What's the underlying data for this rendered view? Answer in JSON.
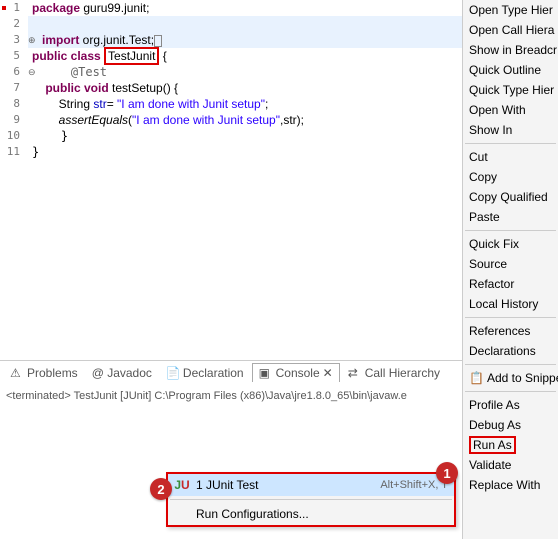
{
  "code": {
    "line1_pkg": "package",
    "line1_rest": " guru99.junit;",
    "line3_imp": "import",
    "line3_rest": " org.junit.Test;",
    "line5_pub": "public",
    "line5_cls": " class ",
    "line5_name": "TestJunit",
    "line5_brace": " {",
    "line6": "    @Test",
    "line7_pub": "    public",
    "line7_void": " void",
    "line7_rest": " testSetup() {",
    "line8_pre": "        String ",
    "line8_var": "str",
    "line8_eq": "= ",
    "line8_str": "\"I am done with Junit setup\"",
    "line8_end": ";",
    "line9_pre": "        ",
    "line9_mth": "assertEquals",
    "line9_open": "(",
    "line9_str": "\"I am done with Junit setup\"",
    "line9_end": ",str);",
    "line10": "    }",
    "line11": "}"
  },
  "tabs": {
    "problems": "Problems",
    "javadoc": "@ Javadoc",
    "declaration": "Declaration",
    "console": "Console",
    "callhier": "Call Hierarchy"
  },
  "terminated": "<terminated> TestJunit [JUnit] C:\\Program Files (x86)\\Java\\jre1.8.0_65\\bin\\javaw.e",
  "menu": {
    "openTypeHier": "Open Type Hier",
    "openCallHier": "Open Call Hiera",
    "showBreadcr": "Show in Breadcr",
    "quickOutline": "Quick Outline",
    "quickTypeHier": "Quick Type Hier",
    "openWith": "Open With",
    "showIn": "Show In",
    "cut": "Cut",
    "copy": "Copy",
    "copyQualified": "Copy Qualified",
    "paste": "Paste",
    "quickFix": "Quick Fix",
    "source": "Source",
    "refactor": "Refactor",
    "localHistory": "Local History",
    "references": "References",
    "declarations": "Declarations",
    "addSnippets": "Add to Snippets",
    "profileAs": "Profile As",
    "debugAs": "Debug As",
    "runAs": "Run As",
    "validate": "Validate",
    "replaceWith": "Replace With"
  },
  "submenu": {
    "junitIcon": "JU",
    "junitTest": "1 JUnit Test",
    "junitShortcut": "Alt+Shift+X, T",
    "runConfig": "Run Configurations..."
  },
  "callouts": {
    "one": "1",
    "two": "2"
  },
  "lineNumbers": [
    "1",
    "2",
    "3",
    "5",
    "6",
    "7",
    "8",
    "9",
    "10",
    "11"
  ]
}
